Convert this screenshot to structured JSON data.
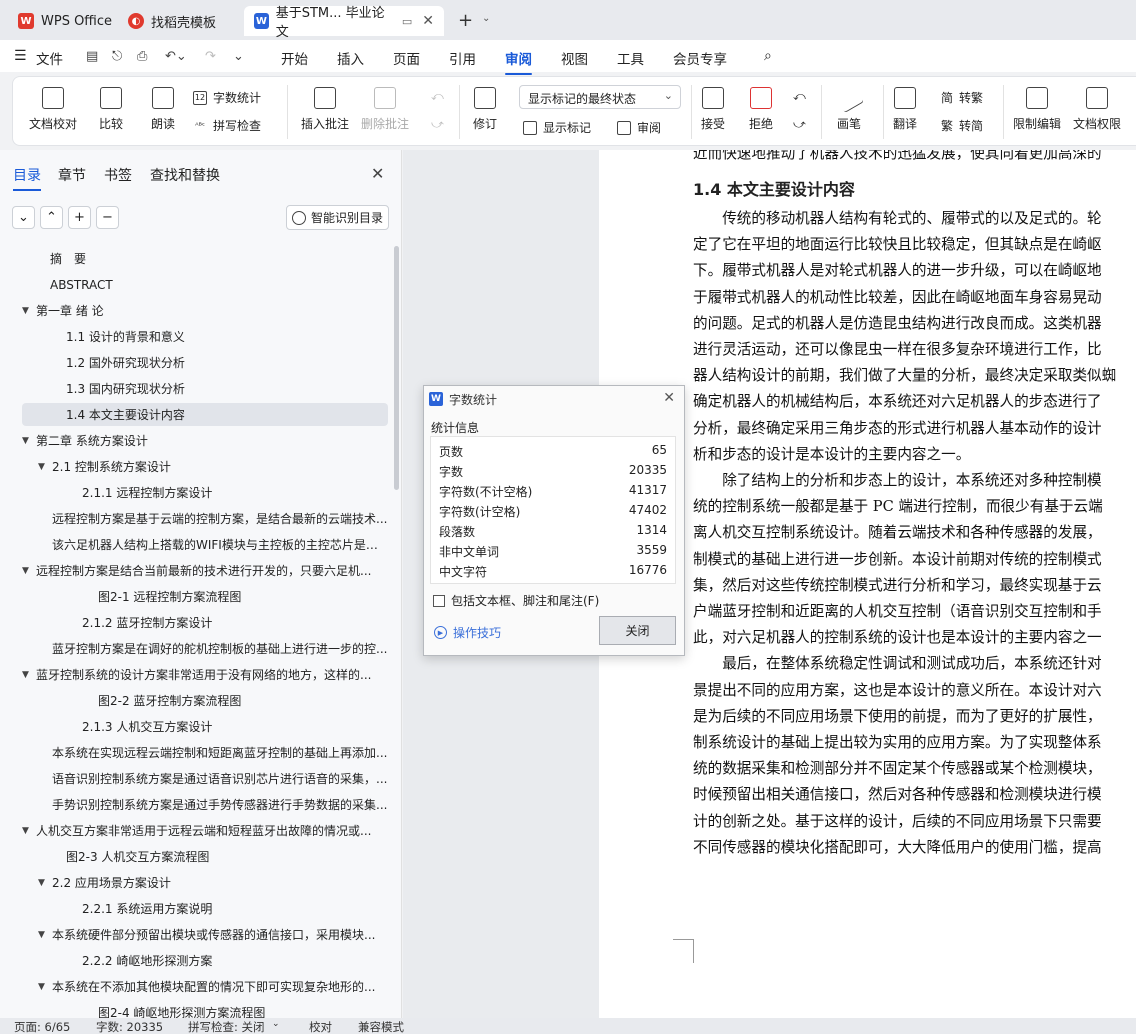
{
  "tabs": [
    {
      "label": "WPS Office",
      "icon": "wps-logo-icon",
      "color": "#e03a2e"
    },
    {
      "label": "找稻壳模板",
      "icon": "docer-icon",
      "color": "#e03a2e"
    },
    {
      "label": "基于STM... 毕业论文",
      "icon": "word-doc-icon",
      "color": "#2a63d8",
      "active": true
    }
  ],
  "menu": {
    "file": "文件",
    "items": [
      "开始",
      "插入",
      "页面",
      "引用",
      "审阅",
      "视图",
      "工具",
      "会员专享"
    ],
    "active": "审阅"
  },
  "ribbon": {
    "doc_check": "文档校对",
    "compare": "比较",
    "read_aloud": "朗读",
    "word_count": "字数统计",
    "spell_check": "拼写检查",
    "insert_comment": "插入批注",
    "delete_comment": "删除批注",
    "revise": "修订",
    "markup_dropdown": "显示标记的最终状态",
    "show_markup": "显示标记",
    "review": "审阅",
    "accept": "接受",
    "reject": "拒绝",
    "ink": "画笔",
    "translate": "翻译",
    "to_traditional": "转繁",
    "to_simplified": "转简",
    "restrict_edit": "限制编辑",
    "doc_permission": "文档权限"
  },
  "nav": {
    "tabs": [
      "目录",
      "章节",
      "书签",
      "查找和替换"
    ],
    "active_tab": "目录",
    "smart_toc": "智能识别目录",
    "items": [
      {
        "text": "摘　要",
        "indent": 0,
        "arrow": ""
      },
      {
        "text": "ABSTRACT",
        "indent": 0,
        "arrow": ""
      },
      {
        "text": "第一章 绪 论",
        "indent": 0,
        "arrow": "▼"
      },
      {
        "text": "1.1 设计的背景和意义",
        "indent": 1,
        "arrow": ""
      },
      {
        "text": "1.2 国外研究现状分析",
        "indent": 1,
        "arrow": ""
      },
      {
        "text": "1.3 国内研究现状分析",
        "indent": 1,
        "arrow": ""
      },
      {
        "text": "1.4 本文主要设计内容",
        "indent": 1,
        "arrow": "",
        "selected": true
      },
      {
        "text": "第二章 系统方案设计",
        "indent": 0,
        "arrow": "▼"
      },
      {
        "text": "2.1 控制系统方案设计",
        "indent": 1,
        "arrow": "▼"
      },
      {
        "text": "2.1.1 远程控制方案设计",
        "indent": 2,
        "arrow": ""
      },
      {
        "text": "远程控制方案是基于云端的控制方案，是结合最新的云端技术...",
        "indent": -1,
        "arrow": ""
      },
      {
        "text": "该六足机器人结构上搭载的WIFI模块与主控板的主控芯片是用...",
        "indent": -1,
        "arrow": ""
      },
      {
        "text": "远程控制方案是结合当前最新的技术进行开发的，只要六足机...",
        "indent": 0,
        "arrow": "▼"
      },
      {
        "text": "图2-1 远程控制方案流程图",
        "indent": 3,
        "arrow": ""
      },
      {
        "text": "2.1.2 蓝牙控制方案设计",
        "indent": 2,
        "arrow": ""
      },
      {
        "text": "蓝牙控制方案是在调好的舵机控制板的基础上进行进一步的控...",
        "indent": -1,
        "arrow": ""
      },
      {
        "text": "蓝牙控制系统的设计方案非常适用于没有网络的地方，这样的...",
        "indent": 0,
        "arrow": "▼"
      },
      {
        "text": "图2-2 蓝牙控制方案流程图",
        "indent": 3,
        "arrow": ""
      },
      {
        "text": "2.1.3 人机交互方案设计",
        "indent": 2,
        "arrow": ""
      },
      {
        "text": "本系统在实现远程云端控制和短距离蓝牙控制的基础上再添加...",
        "indent": -1,
        "arrow": ""
      },
      {
        "text": "语音识别控制系统方案是通过语音识别芯片进行语音的采集，...",
        "indent": -1,
        "arrow": ""
      },
      {
        "text": "手势识别控制系统方案是通过手势传感器进行手势数据的采集...",
        "indent": -1,
        "arrow": ""
      },
      {
        "text": "人机交互方案非常适用于远程云端和短程蓝牙出故障的情况或...",
        "indent": 0,
        "arrow": "▼"
      },
      {
        "text": "图2-3 人机交互方案流程图",
        "indent": 1,
        "arrow": ""
      },
      {
        "text": "2.2 应用场景方案设计",
        "indent": 1,
        "arrow": "▼"
      },
      {
        "text": "2.2.1 系统运用方案说明",
        "indent": 2,
        "arrow": ""
      },
      {
        "text": "本系统硬件部分预留出模块或传感器的通信接口，采用模块...",
        "indent": 1,
        "arrow": "▼"
      },
      {
        "text": "2.2.2 崎岖地形探测方案",
        "indent": 2,
        "arrow": ""
      },
      {
        "text": "本系统在不添加其他模块配置的情况下即可实现复杂地形的...",
        "indent": 1,
        "arrow": "▼"
      },
      {
        "text": "图2-4 崎岖地形探测方案流程图",
        "indent": 3,
        "arrow": ""
      }
    ]
  },
  "document": {
    "top_partial": "近而快速地推动了机器人技术的迅猛发展，使其向着更加高深的",
    "heading": "1.4 本文主要设计内容",
    "lines": [
      "　　传统的移动机器人结构有轮式的、履带式的以及足式的。轮",
      "定了它在平坦的地面运行比较快且比较稳定，但其缺点是在崎岖",
      "下。履带式机器人是对轮式机器人的进一步升级，可以在崎岖地",
      "于履带式机器人的机动性比较差，因此在崎岖地面车身容易晃动",
      "的问题。足式的机器人是仿造昆虫结构进行改良而成。这类机器",
      "进行灵活运动，还可以像昆虫一样在很多复杂环境进行工作，比",
      "器人结构设计的前期，我们做了大量的分析，最终决定采取类似蜘",
      "确定机器人的机械结构后，本系统还对六足机器人的步态进行了",
      "分析，最终确定采用三角步态的形式进行机器人基本动作的设计",
      "析和步态的设计是本设计的主要内容之一。",
      "　　除了结构上的分析和步态上的设计，本系统还对多种控制模",
      "统的控制系统一般都是基于 PC 端进行控制，而很少有基于云端",
      "离人机交互控制系统设计。随着云端技术和各种传感器的发展，",
      "制模式的基础上进行进一步创新。本设计前期对传统的控制模式",
      "集，然后对这些传统控制模式进行分析和学习，最终实现基于云",
      "户端蓝牙控制和近距离的人机交互控制（语音识别交互控制和手",
      "此，对六足机器人的控制系统的设计也是本设计的主要内容之一",
      "　　最后，在整体系统稳定性调试和测试成功后，本系统还针对",
      "景提出不同的应用方案，这也是本设计的意义所在。本设计对六",
      "是为后续的不同应用场景下使用的前提，而为了更好的扩展性，",
      "制系统设计的基础上提出较为实用的应用方案。为了实现整体系",
      "统的数据采集和检测部分并不固定某个传感器或某个检测模块，",
      "时候预留出相关通信接口，然后对各种传感器和检测模块进行模",
      "计的创新之处。基于这样的设计，后续的不同应用场景下只需要",
      "不同传感器的模块化搭配即可，大大降低用户的使用门槛，提高"
    ]
  },
  "dialog": {
    "title": "字数统计",
    "section": "统计信息",
    "stats": [
      {
        "label": "页数",
        "value": "65"
      },
      {
        "label": "字数",
        "value": "20335"
      },
      {
        "label": "字符数(不计空格)",
        "value": "41317"
      },
      {
        "label": "字符数(计空格)",
        "value": "47402"
      },
      {
        "label": "段落数",
        "value": "1314"
      },
      {
        "label": "非中文单词",
        "value": "3559"
      },
      {
        "label": "中文字符",
        "value": "16776"
      }
    ],
    "checkbox": "包括文本框、脚注和尾注(F)",
    "tips": "操作技巧",
    "close": "关闭"
  },
  "status": {
    "page": "页面: 6/65",
    "words": "字数: 20335",
    "spell": "拼写检查: 关闭",
    "proof": "校对",
    "compat": "兼容模式"
  }
}
